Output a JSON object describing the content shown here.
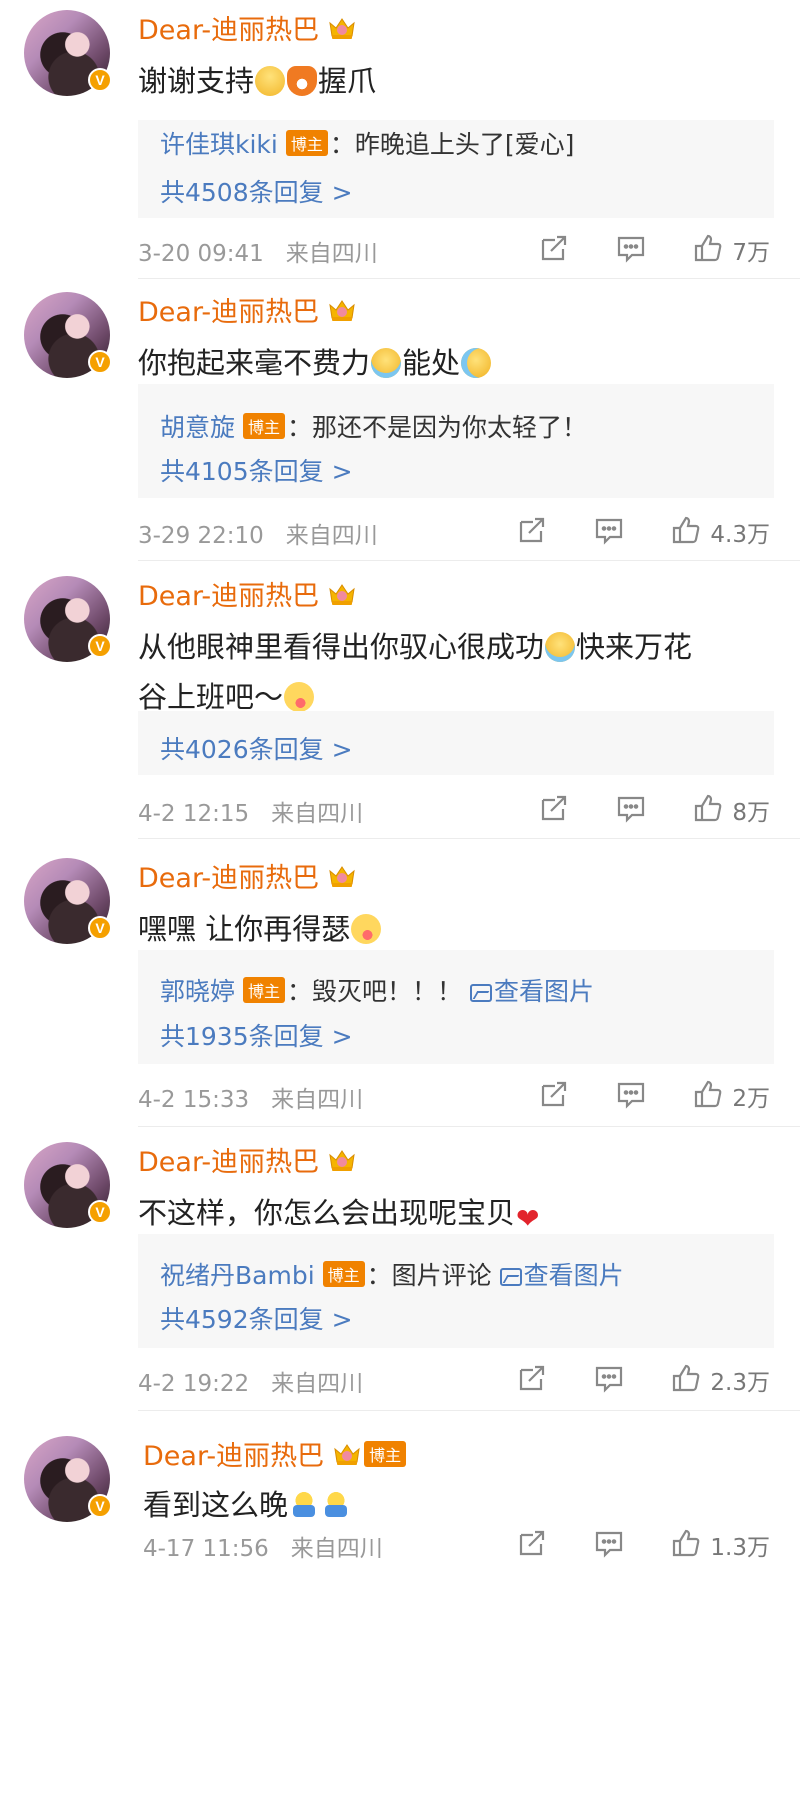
{
  "comments": [
    {
      "user": "Dear-迪丽热巴",
      "verified": "V",
      "blogger_tag": "",
      "text_lines": [
        [
          {
            "t": "谢谢支持"
          },
          {
            "e": "grin"
          },
          {
            "e": "fox"
          },
          {
            "t": "握爪"
          }
        ]
      ],
      "reply": {
        "name": "许佳琪kiki",
        "tag": "博主",
        "text": "：昨晚追上头了[爱心]",
        "image_link": ""
      },
      "reply_count": "共4508条回复 >",
      "time": "3-20 09:41",
      "location": "来自四川",
      "likes": "7万"
    },
    {
      "user": "Dear-迪丽热巴",
      "verified": "V",
      "blogger_tag": "",
      "text_lines": [
        [
          {
            "t": "你抱起来毫不费力"
          },
          {
            "e": "cry"
          },
          {
            "t": "能处"
          },
          {
            "e": "sweat"
          }
        ]
      ],
      "reply": {
        "name": "胡意旋",
        "tag": "博主",
        "text": "：那还不是因为你太轻了！",
        "image_link": ""
      },
      "reply_count": "共4105条回复 >",
      "time": "3-29 22:10",
      "location": "来自四川",
      "likes": "4.3万"
    },
    {
      "user": "Dear-迪丽热巴",
      "verified": "V",
      "blogger_tag": "",
      "text_lines": [
        [
          {
            "t": "从他眼神里看得出你驭心很成功"
          },
          {
            "e": "cry"
          },
          {
            "t": "快来万花"
          }
        ],
        [
          {
            "t": "谷上班吧～"
          },
          {
            "e": "tongue"
          }
        ]
      ],
      "reply": null,
      "reply_count": "共4026条回复 >",
      "time": "4-2 12:15",
      "location": "来自四川",
      "likes": "8万"
    },
    {
      "user": "Dear-迪丽热巴",
      "verified": "V",
      "blogger_tag": "",
      "text_lines": [
        [
          {
            "t": "嘿嘿 让你再得瑟"
          },
          {
            "e": "tongue"
          }
        ]
      ],
      "reply": {
        "name": "郭晓婷",
        "tag": "博主",
        "text": "：毁灭吧！！！",
        "image_link": "查看图片"
      },
      "reply_count": "共1935条回复 >",
      "time": "4-2 15:33",
      "location": "来自四川",
      "likes": "2万"
    },
    {
      "user": "Dear-迪丽热巴",
      "verified": "V",
      "blogger_tag": "",
      "text_lines": [
        [
          {
            "t": "不这样，你怎么会出现呢宝贝"
          },
          {
            "e": "heart"
          }
        ]
      ],
      "reply": {
        "name": "祝绪丹Bambi",
        "tag": "博主",
        "text": "：图片评论",
        "image_link": "查看图片"
      },
      "reply_count": "共4592条回复 >",
      "time": "4-2 19:22",
      "location": "来自四川",
      "likes": "2.3万"
    },
    {
      "user": "Dear-迪丽热巴",
      "verified": "V",
      "blogger_tag": "博主",
      "text_lines": [
        [
          {
            "t": "看到这么晚"
          },
          {
            "e": "shy"
          },
          {
            "e": "shy"
          }
        ]
      ],
      "reply": null,
      "reply_count": "",
      "time": "4-17 11:56",
      "location": "来自四川",
      "likes": "1.3万"
    }
  ],
  "icons": {
    "repost": "share-icon",
    "comment": "comment-icon",
    "like": "thumbs-up-icon",
    "crown": "crown-icon"
  },
  "colors": {
    "username": "#e86b0c",
    "link": "#4b7bbf",
    "tag": "#f08200",
    "meta": "#999999"
  }
}
